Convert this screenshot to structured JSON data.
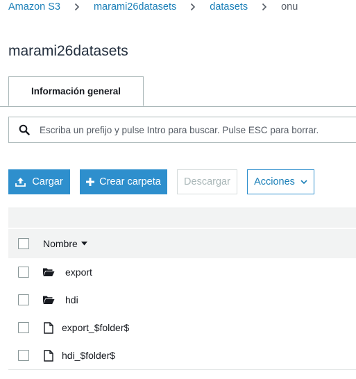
{
  "breadcrumb": {
    "items": [
      "Amazon S3",
      "marami26datasets",
      "datasets"
    ],
    "current": "onu",
    "separator": "›"
  },
  "page": {
    "title": "marami26datasets"
  },
  "tabs": [
    {
      "label": "Información general",
      "active": true
    }
  ],
  "search": {
    "placeholder": "Escriba un prefijo y pulse Intro para buscar. Pulse ESC para borrar.",
    "value": ""
  },
  "toolbar": {
    "upload_label": "Cargar",
    "create_folder_label": "Crear carpeta",
    "download_label": "Descargar",
    "actions_label": "Acciones"
  },
  "table": {
    "column_name": "Nombre",
    "rows": [
      {
        "name": "export",
        "type": "folder"
      },
      {
        "name": "hdi",
        "type": "folder"
      },
      {
        "name": "export_$folder$",
        "type": "file"
      },
      {
        "name": "hdi_$folder$",
        "type": "file"
      }
    ]
  },
  "colors": {
    "link": "#1a7fb8",
    "primary_button": "#2e8fcd",
    "header_bg": "#f2f3f3"
  },
  "icons": {
    "upload": "upload-icon",
    "plus": "plus-icon",
    "search": "search-icon",
    "folder": "folder-icon",
    "file": "file-icon",
    "chevron": "chevron-down-icon",
    "sort": "sort-caret-icon"
  }
}
